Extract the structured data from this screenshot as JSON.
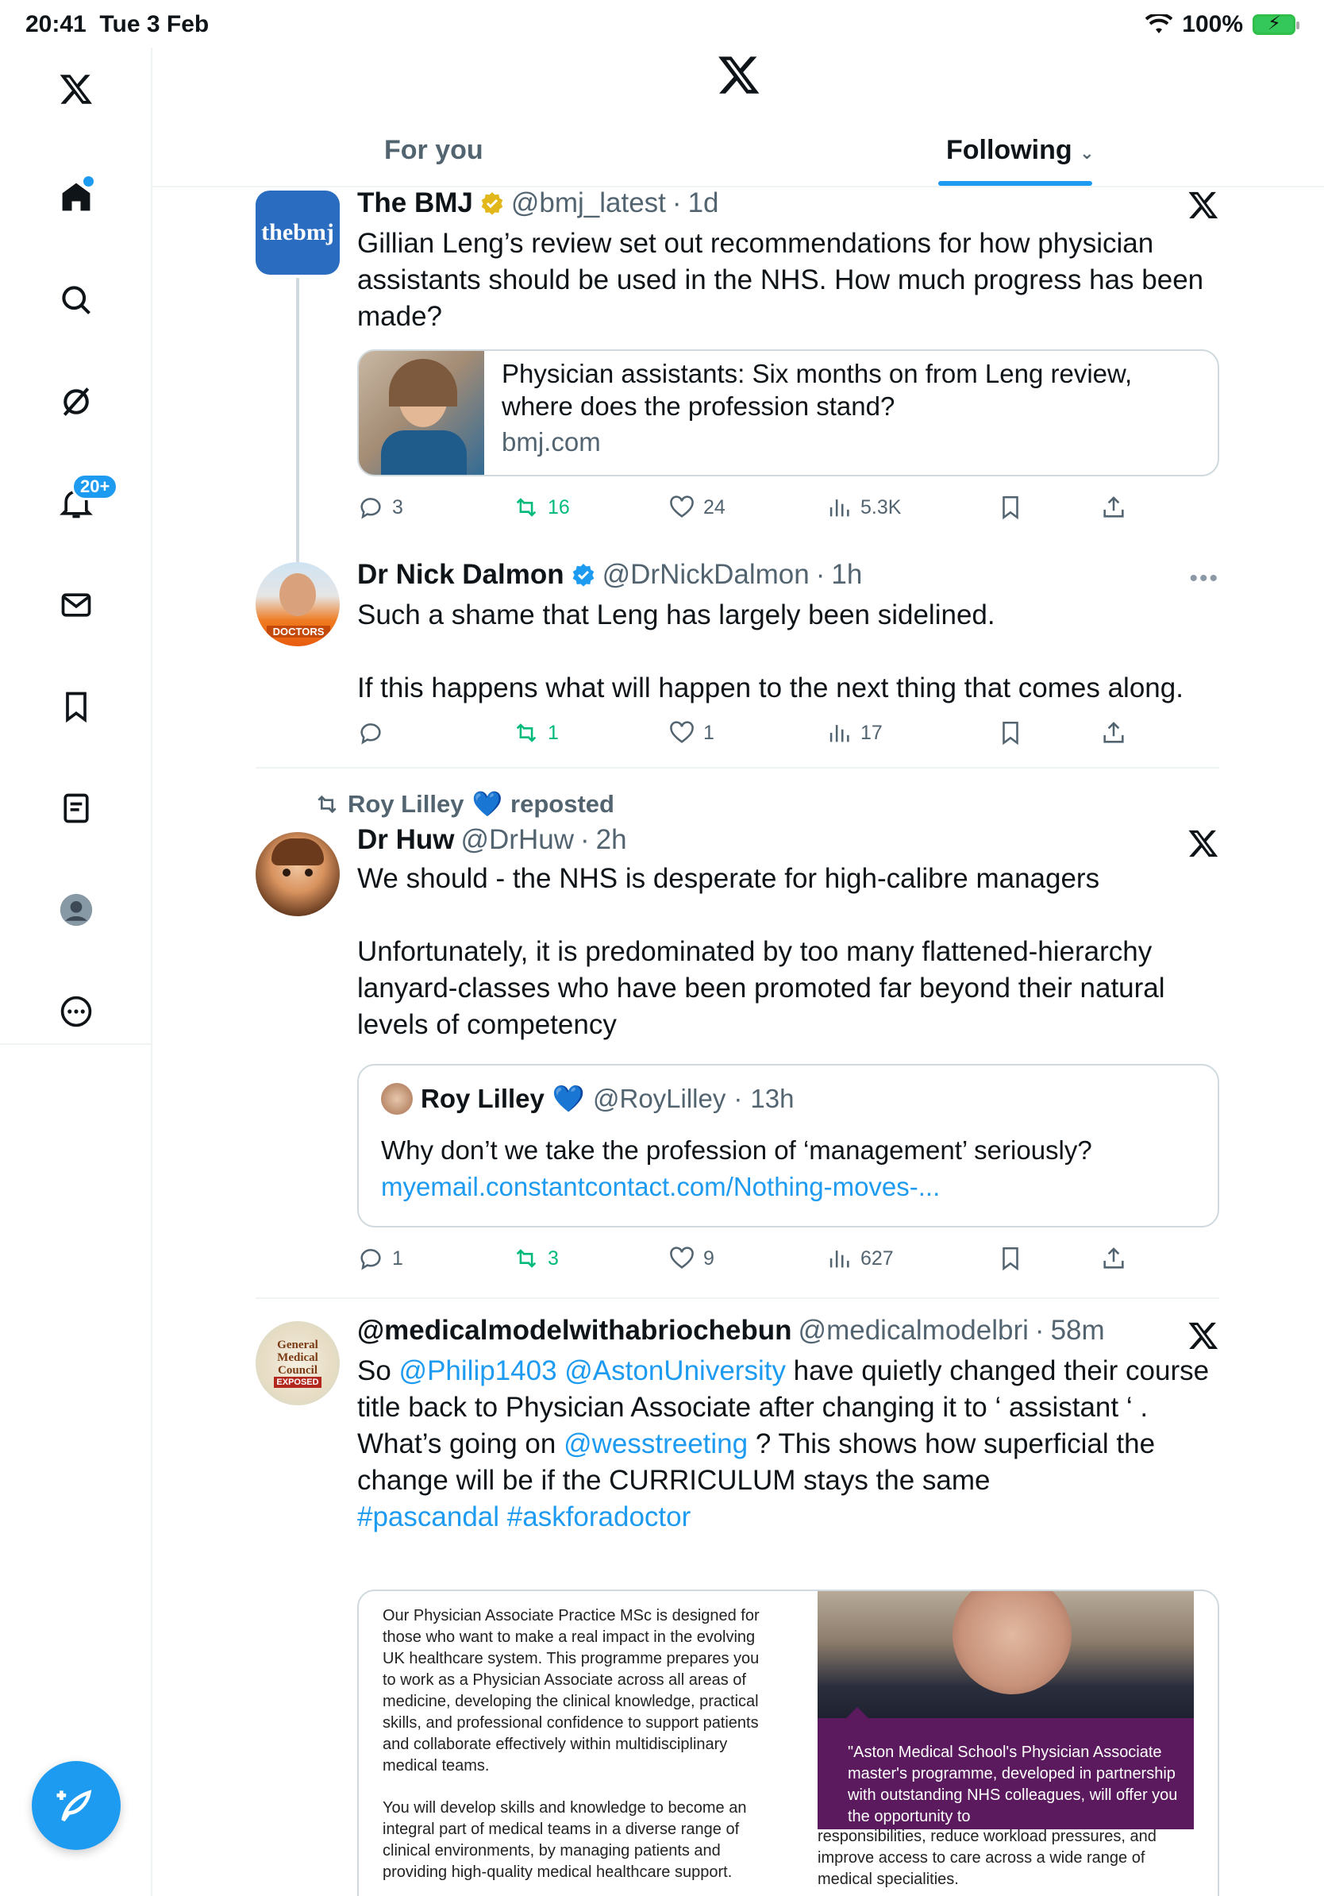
{
  "status_bar": {
    "time": "20:41",
    "date": "Tue 3 Feb",
    "battery": "100%"
  },
  "sidebar": {
    "items": [
      {
        "icon": "x-logo-icon"
      },
      {
        "icon": "home-icon"
      },
      {
        "icon": "search-icon"
      },
      {
        "icon": "grok-icon"
      },
      {
        "icon": "bell-icon",
        "badge": "20+"
      },
      {
        "icon": "mail-icon"
      },
      {
        "icon": "bookmark-icon"
      },
      {
        "icon": "lists-icon"
      },
      {
        "icon": "profile-icon"
      },
      {
        "icon": "more-icon"
      }
    ]
  },
  "tabs": [
    {
      "label": "For you",
      "active": false
    },
    {
      "label": "Following",
      "active": true
    }
  ],
  "posts": [
    {
      "name": "The BMJ",
      "handle": "@bmj_latest",
      "time": "1d",
      "avatar_text": "thebmj",
      "text": "Gillian Leng’s review set out recommendations for how physician assistants should be used in the NHS. How much progress has been made?",
      "card": {
        "title": "Physician assistants: Six months on from Leng review, where does the profession stand?",
        "domain": "bmj.com"
      },
      "stats": {
        "replies": "3",
        "reposts": "16",
        "likes": "24",
        "views": "5.3K"
      }
    },
    {
      "name": "Dr Nick Dalmon",
      "handle": "@DrNickDalmon",
      "time": "1h",
      "avatar_text": "DOCTORS",
      "text_lines": [
        "Such a shame that Leng has largely been sidelined.",
        "If this happens what will happen to the next thing that comes along."
      ],
      "stats": {
        "replies": "",
        "reposts": "1",
        "likes": "1",
        "views": "17"
      }
    },
    {
      "repost_by": "Roy Lilley",
      "repost_label": "reposted",
      "name": "Dr Huw",
      "handle": "@DrHuw",
      "time": "2h",
      "text_lines": [
        "We should - the NHS is desperate for high-calibre managers",
        "Unfortunately, it is predominated by too many flattened-hierarchy lanyard-classes who have been promoted far beyond their natural levels of competency"
      ],
      "quote": {
        "name": "Roy Lilley",
        "handle": "@RoyLilley",
        "time": "13h",
        "text": "Why don’t we take the profession of ‘management’ seriously?",
        "link": "myemail.constantcontact.com/Nothing-moves-..."
      },
      "stats": {
        "replies": "1",
        "reposts": "3",
        "likes": "9",
        "views": "627"
      }
    },
    {
      "name": "@medicalmodelwithabriochebun",
      "handle": "@medicalmodelbri",
      "time": "58m",
      "avatar_lines": [
        "General",
        "Medical",
        "Council",
        "EXPOSED"
      ],
      "text_parts": {
        "line1_pre": "So ",
        "mention1": "@Philip1403",
        "mention2": "@AstonUniversity",
        "line1_post": " have quietly changed their course title back to Physician Associate after changing it to ‘ assistant ‘ .",
        "line2_pre": "What’s going on ",
        "mention3": "@wesstreeting",
        "line2_post": " ? This shows how superficial the change will be if the CURRICULUM stays the same",
        "hashtags": "#pascandal #askforadoctor"
      },
      "image": {
        "left_text_1": "Our Physician Associate Practice MSc is designed for those who want to make a real impact in the evolving UK healthcare system. This programme prepares you to work as a Physician Associate across all areas of medicine, developing the clinical knowledge, practical skills, and professional confidence to support patients and collaborate effectively within multidisciplinary medical teams.",
        "left_text_2": "You will develop skills and knowledge to become an integral part of medical teams in a diverse range of clinical environments, by managing patients and providing high-quality medical healthcare support.",
        "quote_text": "\"Aston Medical School's Physician Associate master's programme, developed in partnership with outstanding NHS colleagues, will offer you the opportunity to",
        "right_text": "responsibilities, reduce workload pressures, and improve access to care across a wide range of medical specialities."
      }
    }
  ],
  "colors": {
    "accent": "#1d9bf0",
    "repost_green": "#00ba7c",
    "muted": "#536471",
    "quote_purple": "#5b1a5e"
  }
}
